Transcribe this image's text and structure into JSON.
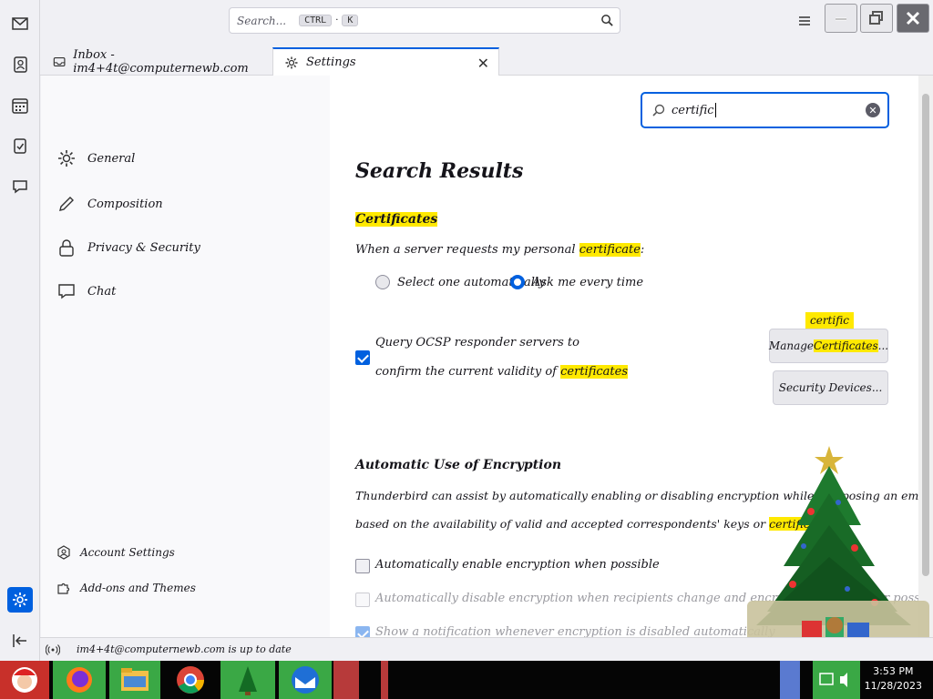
{
  "window": {
    "search_placeholder": "Search...",
    "search_key1": "CTRL",
    "search_key2": "K"
  },
  "tabs": [
    {
      "label": "Inbox - im4+4t@computernewb.com",
      "selected": false
    },
    {
      "label": "Settings",
      "selected": true
    }
  ],
  "settings_nav": {
    "items": [
      {
        "label": "General",
        "icon": "gear-icon"
      },
      {
        "label": "Composition",
        "icon": "pencil-icon"
      },
      {
        "label": "Privacy & Security",
        "icon": "lock-icon"
      },
      {
        "label": "Chat",
        "icon": "chat-icon"
      }
    ],
    "account_settings": "Account Settings",
    "addons": "Add-ons and Themes"
  },
  "pref_search": {
    "value": "certific"
  },
  "content": {
    "search_results_title": "Search Results",
    "certificates": {
      "heading": "Certificates",
      "prompt_pre": "When a server requests my personal ",
      "prompt_hl": "certificate",
      "prompt_post": ":",
      "radio_auto": "Select one automatically",
      "radio_ask": "Ask me every time",
      "ocsp_line1": "Query OCSP responder servers to",
      "ocsp_line2_pre": "confirm the current validity of ",
      "ocsp_line2_hl": "certificates",
      "tooltip": "certific",
      "manage_pre": "Manage ",
      "manage_hl": "Certificates",
      "manage_post": "...",
      "security_devices": "Security Devices..."
    },
    "encryption": {
      "heading": "Automatic Use of Encryption",
      "desc_line1": "Thunderbird can assist by automatically enabling or disabling encryption while composing an email. Auto encryption handling is",
      "desc_line2_pre": "based on the availability of valid and accepted correspondents' keys or ",
      "desc_line2_hl": "certificates",
      "desc_line2_post": ".",
      "opt1": "Automatically enable encryption when possible",
      "opt2": "Automatically disable encryption when recipients change and encryption is no longer possible",
      "opt3": "Show a notification whenever encryption is disabled automatically"
    }
  },
  "statusbar": {
    "text": "im4+4t@computernewb.com is up to date"
  },
  "taskbar": {
    "time": "3:53 PM",
    "date": "11/28/2023"
  },
  "colors": {
    "accent": "#0060df",
    "highlight": "#ffe900"
  }
}
